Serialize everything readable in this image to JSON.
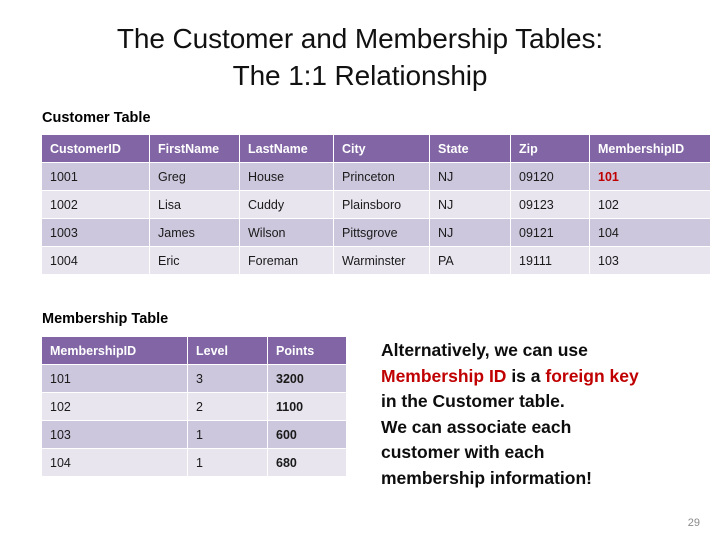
{
  "slide": {
    "title_line_1": "The Customer and Membership Tables:",
    "title_line_2": "The 1:1 Relationship",
    "page_number": "29"
  },
  "colors": {
    "header_purple": "#8165A4",
    "row_odd": "#CCC7DC",
    "row_even": "#E8E5EF",
    "accent_red": "#C00000",
    "background": "#FFFFFF"
  },
  "customer_table": {
    "caption": "Customer Table",
    "columns": [
      "CustomerID",
      "FirstName",
      "LastName",
      "City",
      "State",
      "Zip",
      "MembershipID"
    ],
    "rows": [
      {
        "CustomerID": "1001",
        "FirstName": "Greg",
        "LastName": "House",
        "City": "Princeton",
        "State": "NJ",
        "Zip": "09120",
        "MembershipID": "101"
      },
      {
        "CustomerID": "1002",
        "FirstName": "Lisa",
        "LastName": "Cuddy",
        "City": "Plainsboro",
        "State": "NJ",
        "Zip": "09123",
        "MembershipID": "102"
      },
      {
        "CustomerID": "1003",
        "FirstName": "James",
        "LastName": "Wilson",
        "City": "Pittsgrove",
        "State": "NJ",
        "Zip": "09121",
        "MembershipID": "104"
      },
      {
        "CustomerID": "1004",
        "FirstName": "Eric",
        "LastName": "Foreman",
        "City": "Warminster",
        "State": "PA",
        "Zip": "19111",
        "MembershipID": "103"
      }
    ]
  },
  "membership_table": {
    "caption": "Membership Table",
    "columns": [
      "MembershipID",
      "Level",
      "Points"
    ],
    "rows": [
      {
        "MembershipID": "101",
        "Level": "3",
        "Points": "3200"
      },
      {
        "MembershipID": "102",
        "Level": "2",
        "Points": "1100"
      },
      {
        "MembershipID": "103",
        "Level": "1",
        "Points": "600"
      },
      {
        "MembershipID": "104",
        "Level": "1",
        "Points": "680"
      }
    ]
  },
  "side_note": {
    "line_1": "Alternatively, we can use",
    "line_2_part_1": "Membership ID",
    "line_2_part_2": " is a ",
    "line_2_part_3": "foreign key",
    "line_3": "in the Customer table.",
    "line_4": "We can associate each",
    "line_5": "customer with each",
    "line_6": "membership information!"
  }
}
